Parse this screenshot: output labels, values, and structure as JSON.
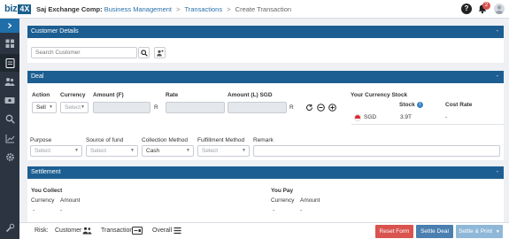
{
  "header": {
    "logo_text": "biz",
    "logo_box": "4X",
    "breadcrumb": {
      "first": "Saj Exchange Comp:",
      "items": [
        "Business Management",
        "Transactions",
        "Create Transaction"
      ],
      "separator": ">"
    },
    "help_label": "?",
    "notification_count": "2"
  },
  "sidebar": {
    "items": [
      "menu-toggle",
      "dashboard",
      "transaction",
      "customers",
      "money",
      "search",
      "reports",
      "settings",
      "tools"
    ]
  },
  "customer_details": {
    "title": "Customer Details",
    "collapse": "-",
    "search_placeholder": "Search Customer"
  },
  "deal": {
    "title": "Deal",
    "collapse": "-",
    "headers": {
      "action": "Action",
      "currency": "Currency",
      "amount_f": "Amount (F)",
      "rate": "Rate",
      "amount_l": "Amount (L) SGD"
    },
    "action_value": "Sell",
    "currency_placeholder": "Select",
    "r_label": "R",
    "your_currency_stock": {
      "title": "Your Currency Stock",
      "col_stock": "Stock",
      "col_cost_rate": "Cost Rate",
      "rows": [
        {
          "currency": "SGD",
          "stock": "3.9T",
          "cost_rate": "-"
        }
      ]
    },
    "fields": {
      "purpose": {
        "label": "Purpose",
        "value": "Select"
      },
      "source_of_fund": {
        "label": "Source of fund",
        "value": "Select"
      },
      "collection_method": {
        "label": "Collection Method",
        "value": "Cash"
      },
      "fulfillment_method": {
        "label": "Fulfillment Method",
        "value": "Select"
      },
      "remark": {
        "label": "Remark",
        "value": ""
      }
    }
  },
  "settlement": {
    "title": "Settlement",
    "collapse": "-",
    "you_collect": {
      "title": "You Collect",
      "col_currency": "Currency",
      "col_amount": "Amount",
      "currency": "-",
      "amount": "-"
    },
    "you_pay": {
      "title": "You Pay",
      "col_currency": "Currency",
      "col_amount": "Amount",
      "currency": "-",
      "amount": "-"
    }
  },
  "footer": {
    "risk_label": "Risk:",
    "customer_label": "Customer",
    "transaction_label": "Transaction",
    "overall_label": "Overall",
    "reset_form": "Reset Form",
    "settle_deal": "Settle Deal",
    "settle_print": "Settle & Print"
  },
  "colors": {
    "panel_header": "#1c5e91",
    "sidebar": "#2b3440",
    "reset_button": "#d9534f",
    "settle_button": "#4a7fb0",
    "settle_print_button": "#8fb8d8"
  }
}
